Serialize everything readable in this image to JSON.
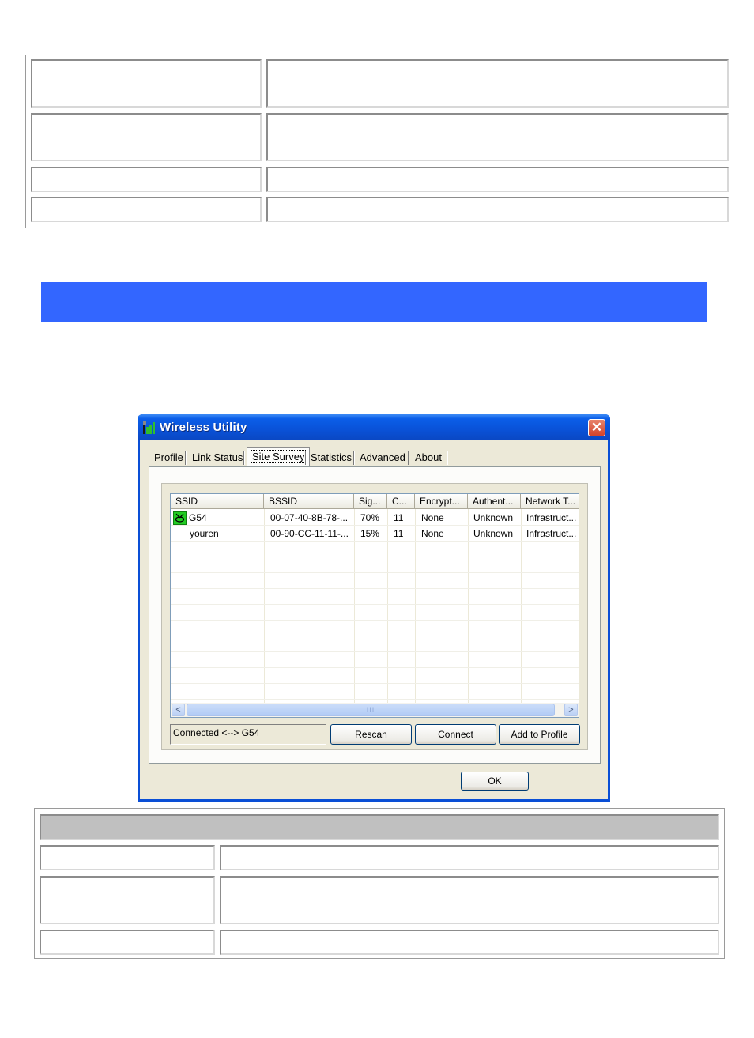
{
  "window": {
    "title": "Wireless Utility",
    "close_glyph": "✕"
  },
  "tabs": [
    {
      "label": "Profile"
    },
    {
      "label": "Link Status"
    },
    {
      "label": "Site Survey",
      "active": true
    },
    {
      "label": "Statistics"
    },
    {
      "label": "Advanced"
    },
    {
      "label": "About"
    }
  ],
  "list": {
    "columns": [
      "SSID",
      "BSSID",
      "Sig...",
      "C...",
      "Encrypt...",
      "Authent...",
      "Network T..."
    ],
    "rows": [
      {
        "ssid": "G54",
        "bssid": "00-07-40-8B-78-...",
        "signal": "70%",
        "channel": "11",
        "encryption": "None",
        "auth": "Unknown",
        "network": "Infrastruct...",
        "connected": true
      },
      {
        "ssid": "youren",
        "bssid": "00-90-CC-11-11-...",
        "signal": "15%",
        "channel": "11",
        "encryption": "None",
        "auth": "Unknown",
        "network": "Infrastruct...",
        "connected": false
      }
    ],
    "scroll_left": "<",
    "scroll_right": ">",
    "scroll_grip": "III"
  },
  "status": {
    "text": "Connected <--> G54"
  },
  "buttons": {
    "rescan": "Rescan",
    "connect": "Connect",
    "add_to_profile": "Add to Profile",
    "ok": "OK"
  },
  "colors": {
    "banner": "#3366ff",
    "titlebar": "#0a52d8",
    "dialog_face": "#ece9d8"
  },
  "icons": {
    "app": "signal-bars-icon",
    "connected_ap": "access-point-icon"
  }
}
